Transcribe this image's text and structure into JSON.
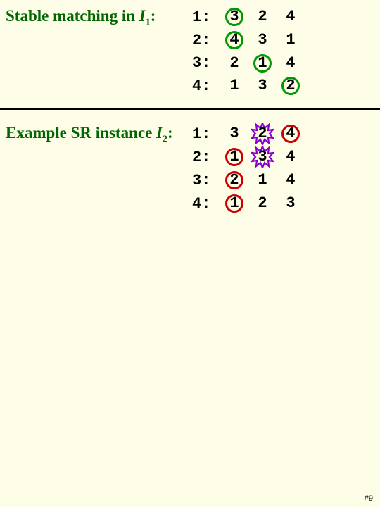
{
  "section1": {
    "label_prefix": "Stable matching in ",
    "label_var": "I",
    "label_sub": "1",
    "rows": [
      {
        "id": "1",
        "prefs": [
          {
            "v": "3",
            "mark": "green"
          },
          {
            "v": "2",
            "mark": null
          },
          {
            "v": "4",
            "mark": null
          }
        ]
      },
      {
        "id": "2",
        "prefs": [
          {
            "v": "4",
            "mark": "green"
          },
          {
            "v": "3",
            "mark": null
          },
          {
            "v": "1",
            "mark": null
          }
        ]
      },
      {
        "id": "3",
        "prefs": [
          {
            "v": "2",
            "mark": null
          },
          {
            "v": "1",
            "mark": "green"
          },
          {
            "v": "4",
            "mark": null
          }
        ]
      },
      {
        "id": "4",
        "prefs": [
          {
            "v": "1",
            "mark": null
          },
          {
            "v": "3",
            "mark": null
          },
          {
            "v": "2",
            "mark": "green"
          }
        ]
      }
    ]
  },
  "section2": {
    "label_prefix": "Example SR instance ",
    "label_var": "I",
    "label_sub": "2",
    "rows": [
      {
        "id": "1",
        "prefs": [
          {
            "v": "3",
            "mark": null
          },
          {
            "v": "2",
            "mark": "star"
          },
          {
            "v": "4",
            "mark": "red"
          }
        ]
      },
      {
        "id": "2",
        "prefs": [
          {
            "v": "1",
            "mark": "red"
          },
          {
            "v": "3",
            "mark": "star"
          },
          {
            "v": "4",
            "mark": null
          }
        ]
      },
      {
        "id": "3",
        "prefs": [
          {
            "v": "2",
            "mark": "red"
          },
          {
            "v": "1",
            "mark": null
          },
          {
            "v": "4",
            "mark": null
          }
        ]
      },
      {
        "id": "4",
        "prefs": [
          {
            "v": "1",
            "mark": "red"
          },
          {
            "v": "2",
            "mark": null
          },
          {
            "v": "3",
            "mark": null
          }
        ]
      }
    ]
  },
  "page_number": "#9"
}
